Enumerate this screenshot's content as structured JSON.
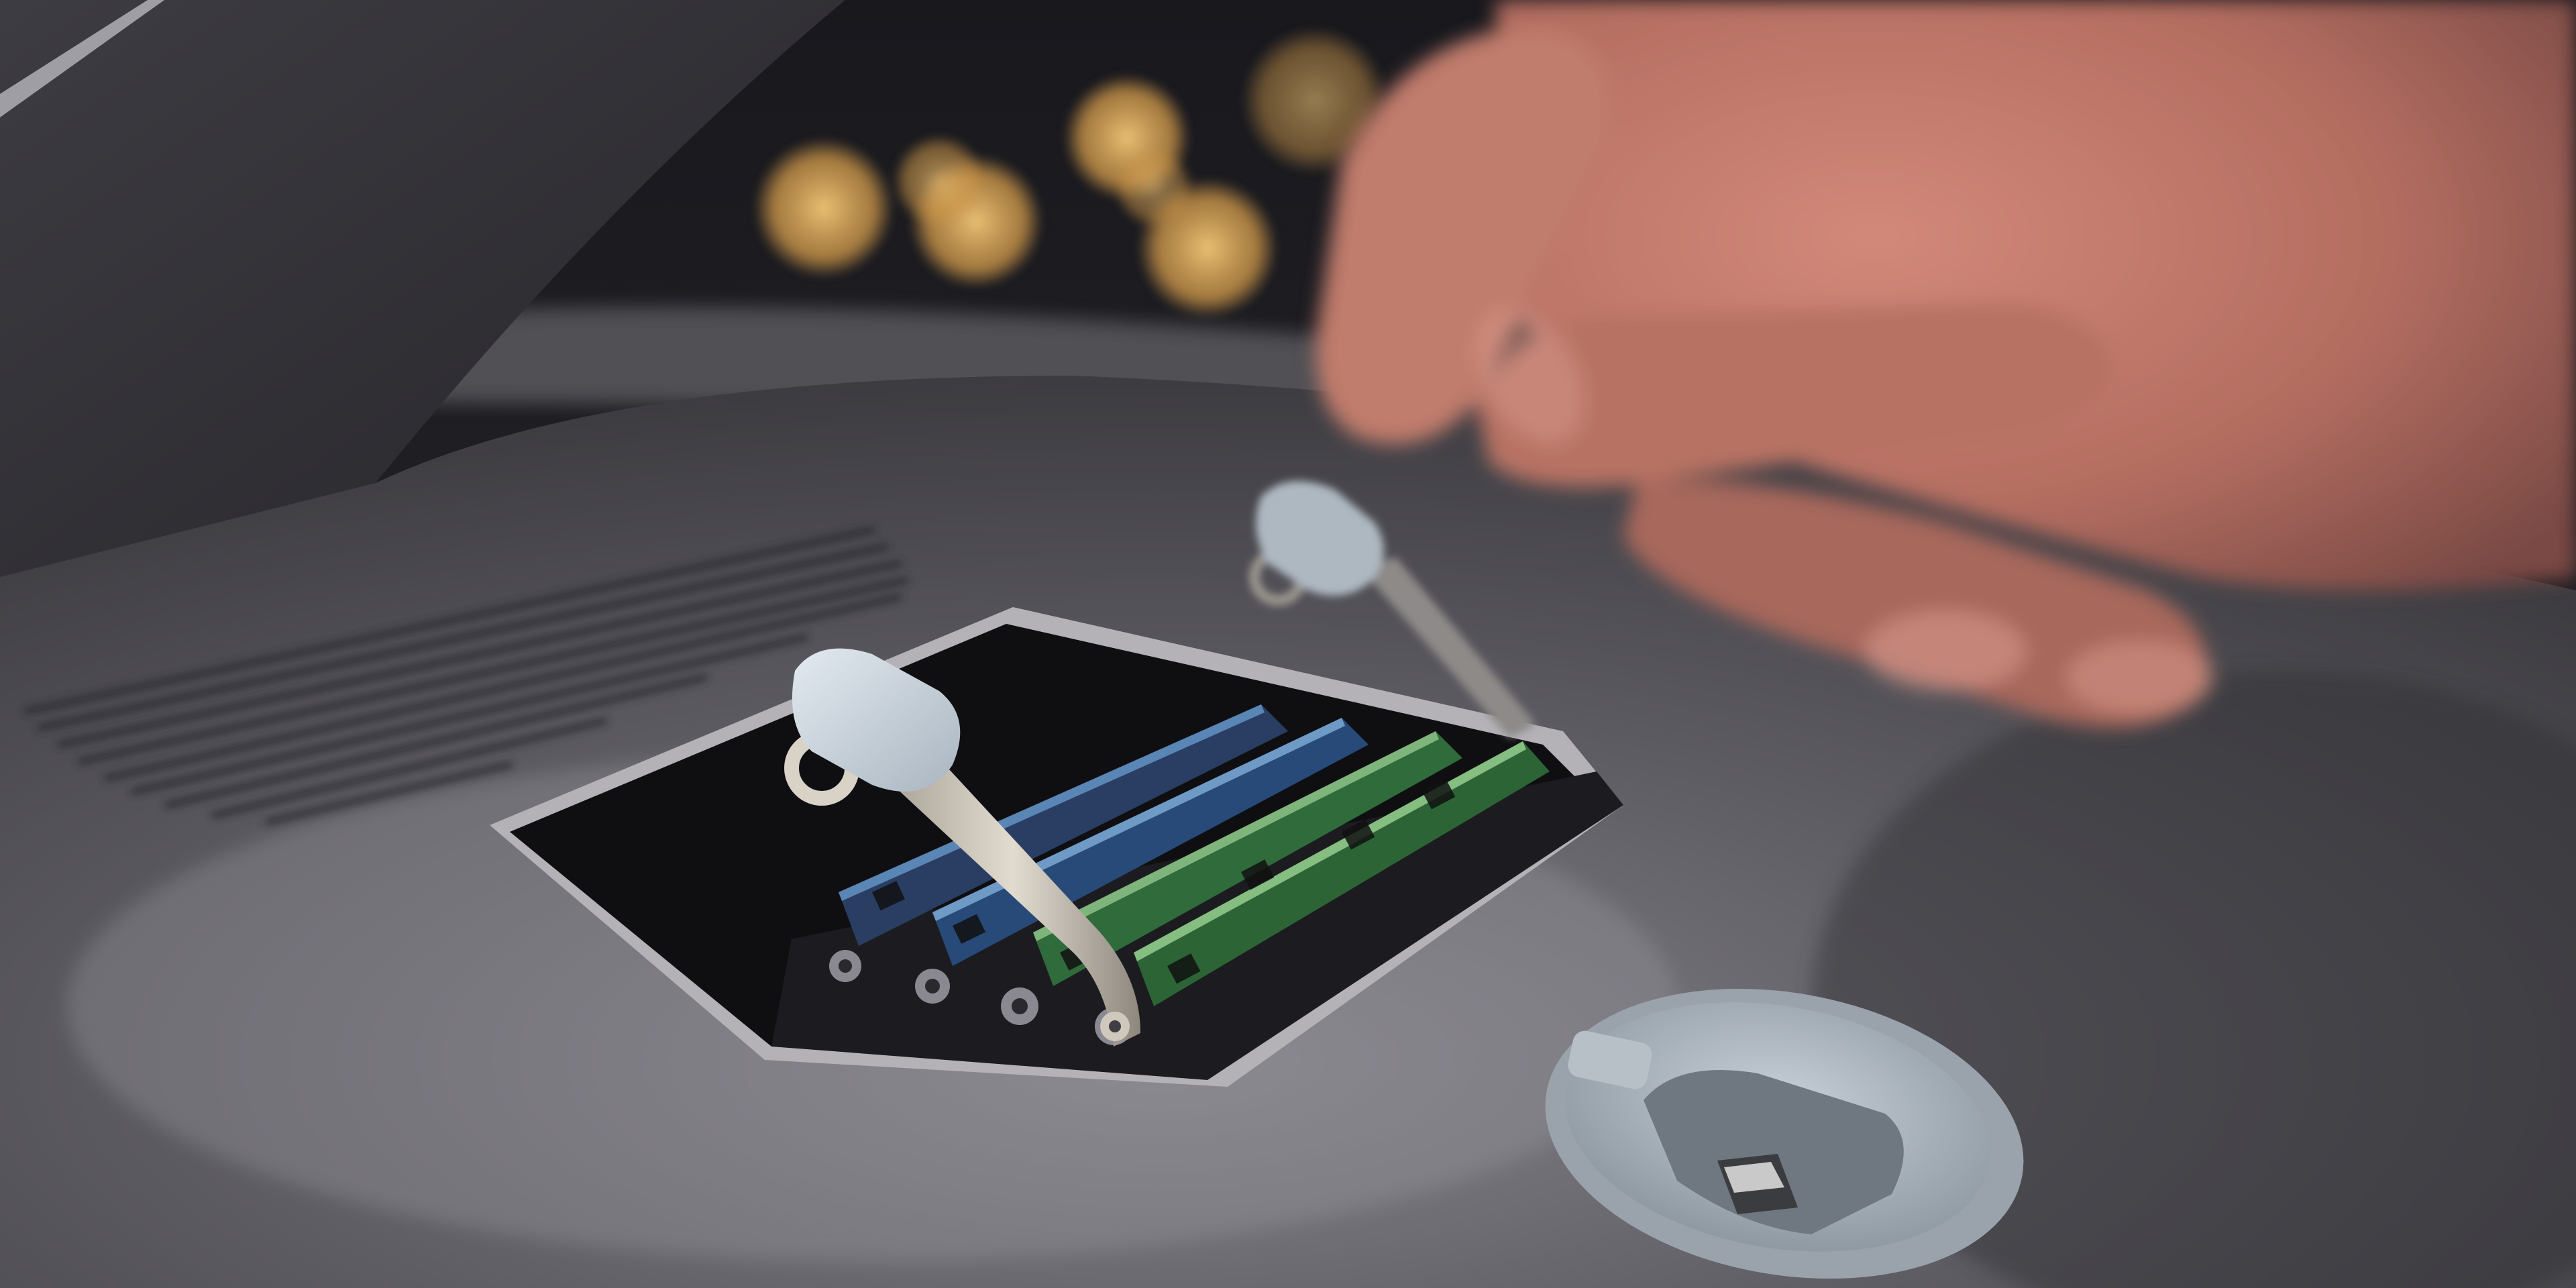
{
  "photo": {
    "subject": "imac-pro-ram-bay",
    "colors": {
      "chassis": "#5f5d63",
      "chassis_dark": "#2e2d32",
      "bokeh_light": "#e8b766",
      "skin": "#c0786a",
      "ram_green": "#2f6b3b",
      "ram_blue": "#274a78",
      "latch": "#c9d3dc"
    }
  }
}
